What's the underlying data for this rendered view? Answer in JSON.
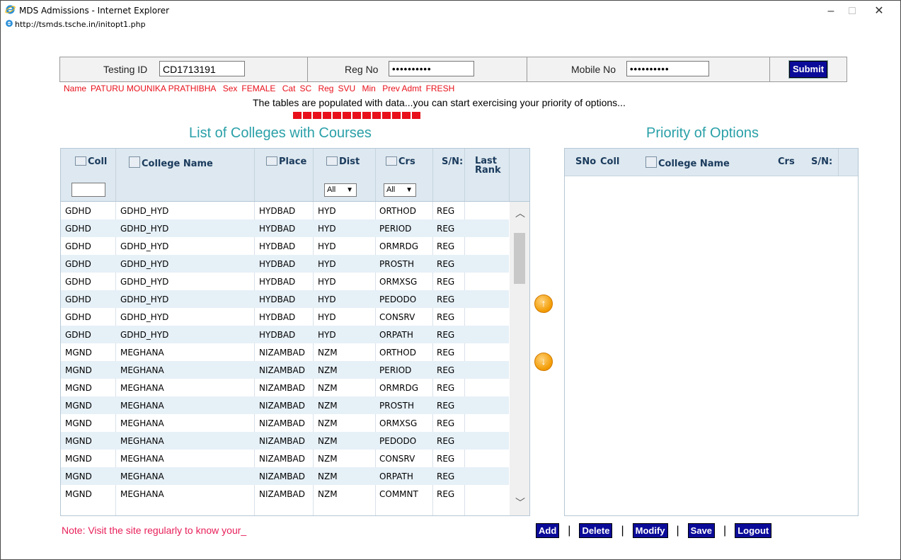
{
  "window": {
    "title": "MDS Admissions - Internet Explorer",
    "url": "http://tsmds.tsche.in/initopt1.php",
    "minimize": "–",
    "maximize": "□",
    "close": "✕"
  },
  "header": {
    "testing_id_label": "Testing ID",
    "testing_id_value": "CD1713191",
    "reg_no_label": "Reg No",
    "reg_no_value": "••••••••••",
    "mobile_no_label": "Mobile No",
    "mobile_no_value": "••••••••••",
    "submit_label": "Submit"
  },
  "candidate": {
    "name_label": "Name",
    "name": "PATURU MOUNIKA PRATHIBHA",
    "sex_label": "Sex",
    "sex": "FEMALE",
    "cat_label": "Cat",
    "cat": "SC",
    "reg_label": "Reg",
    "reg": "SVU",
    "min_label": "Min",
    "prev_label": "Prev Admt",
    "prev": "FRESH"
  },
  "message": "The tables are populated with data...you can start exercising your priority of options...",
  "progress_segments": 13,
  "colors": {
    "accent_teal": "#2aa0a8",
    "alert_red": "#e8101a",
    "button_blue": "#0b0b99",
    "note_pink": "#e8205a"
  },
  "left_table": {
    "title": "List of Colleges with Courses",
    "columns": {
      "coll": "Coll",
      "college_name": "College Name",
      "place": "Place",
      "dist": "Dist",
      "crs": "Crs",
      "sn": "S/N:",
      "last_rank_1": "Last",
      "last_rank_2": "Rank"
    },
    "dist_filter": "All",
    "crs_filter": "All",
    "rows": [
      [
        "GDHD",
        "GDHD_HYD",
        "HYDBAD",
        "HYD",
        "ORTHOD",
        "REG"
      ],
      [
        "GDHD",
        "GDHD_HYD",
        "HYDBAD",
        "HYD",
        "PERIOD",
        "REG"
      ],
      [
        "GDHD",
        "GDHD_HYD",
        "HYDBAD",
        "HYD",
        "ORMRDG",
        "REG"
      ],
      [
        "GDHD",
        "GDHD_HYD",
        "HYDBAD",
        "HYD",
        "PROSTH",
        "REG"
      ],
      [
        "GDHD",
        "GDHD_HYD",
        "HYDBAD",
        "HYD",
        "ORMXSG",
        "REG"
      ],
      [
        "GDHD",
        "GDHD_HYD",
        "HYDBAD",
        "HYD",
        "PEDODO",
        "REG"
      ],
      [
        "GDHD",
        "GDHD_HYD",
        "HYDBAD",
        "HYD",
        "CONSRV",
        "REG"
      ],
      [
        "GDHD",
        "GDHD_HYD",
        "HYDBAD",
        "HYD",
        "ORPATH",
        "REG"
      ],
      [
        "MGND",
        "MEGHANA",
        "NIZAMBAD",
        "NZM",
        "ORTHOD",
        "REG"
      ],
      [
        "MGND",
        "MEGHANA",
        "NIZAMBAD",
        "NZM",
        "PERIOD",
        "REG"
      ],
      [
        "MGND",
        "MEGHANA",
        "NIZAMBAD",
        "NZM",
        "ORMRDG",
        "REG"
      ],
      [
        "MGND",
        "MEGHANA",
        "NIZAMBAD",
        "NZM",
        "PROSTH",
        "REG"
      ],
      [
        "MGND",
        "MEGHANA",
        "NIZAMBAD",
        "NZM",
        "ORMXSG",
        "REG"
      ],
      [
        "MGND",
        "MEGHANA",
        "NIZAMBAD",
        "NZM",
        "PEDODO",
        "REG"
      ],
      [
        "MGND",
        "MEGHANA",
        "NIZAMBAD",
        "NZM",
        "CONSRV",
        "REG"
      ],
      [
        "MGND",
        "MEGHANA",
        "NIZAMBAD",
        "NZM",
        "ORPATH",
        "REG"
      ],
      [
        "MGND",
        "MEGHANA",
        "NIZAMBAD",
        "NZM",
        "COMMNT",
        "REG"
      ]
    ]
  },
  "right_table": {
    "title": "Priority of Options",
    "columns": {
      "sno": "SNo",
      "coll": "Coll",
      "college_name": "College Name",
      "crs": "Crs",
      "sn": "S/N:"
    }
  },
  "footer": {
    "note": "Note: Visit the site regularly to know your_",
    "add": "Add",
    "delete": "Delete",
    "modify": "Modify",
    "save": "Save",
    "logout": "Logout",
    "separator": "|"
  }
}
